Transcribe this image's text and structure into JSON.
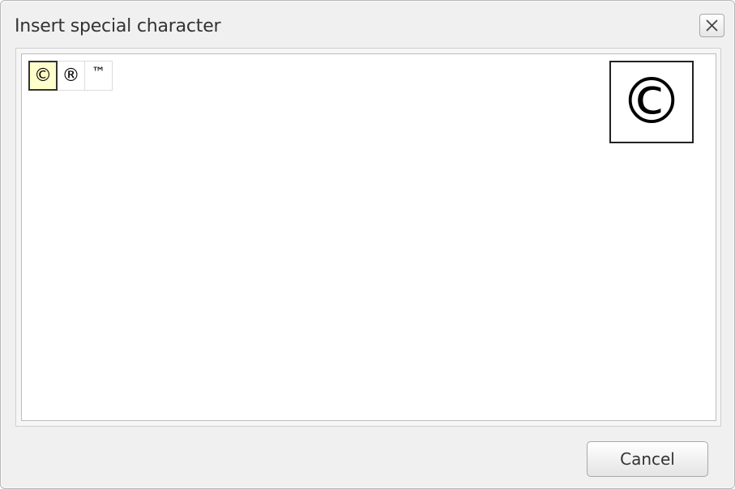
{
  "dialog": {
    "title": "Insert special character",
    "close_icon": "close-x-icon"
  },
  "characters": [
    {
      "glyph": "©",
      "selected": true
    },
    {
      "glyph": "®",
      "selected": false
    },
    {
      "glyph": "™",
      "selected": false
    }
  ],
  "preview": {
    "glyph": "©"
  },
  "footer": {
    "cancel_label": "Cancel"
  }
}
